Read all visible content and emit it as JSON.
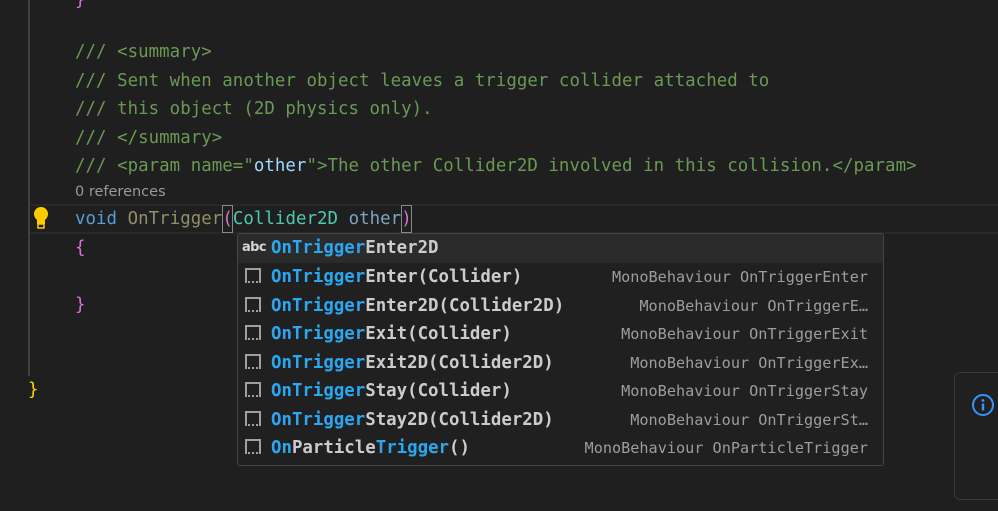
{
  "editor": {
    "lines": {
      "prev_brace": "}",
      "summary_open": "/// <summary>",
      "doc1": "/// Sent when another object leaves a trigger collider attached to",
      "doc2": "/// this object (2D physics only).",
      "summary_close": "/// </summary>",
      "param_prefix": "/// <param name=\"",
      "param_name": "other",
      "param_suffix": "\">The other Collider2D involved in this collision.</param>",
      "codelens": "0 references",
      "kw_void": "void",
      "method_name": "OnTrigger",
      "paren_open": "(",
      "param_type": "Collider2D",
      "param_var": "other",
      "paren_close": ")",
      "brace_open": "{",
      "brace_close": "}",
      "class_brace_close": "}"
    }
  },
  "suggest": {
    "items": [
      {
        "icon": "abc",
        "match": "OnTrigger",
        "rest": "Enter2D",
        "detail": "",
        "selected": true
      },
      {
        "icon": "snippet",
        "match": "OnTrigger",
        "rest": "Enter(Collider)",
        "detail": "MonoBehaviour OnTriggerEnter"
      },
      {
        "icon": "snippet",
        "match": "OnTrigger",
        "rest": "Enter2D(Collider2D)",
        "detail": "MonoBehaviour OnTriggerE…"
      },
      {
        "icon": "snippet",
        "match": "OnTrigger",
        "rest": "Exit(Collider)",
        "detail": "MonoBehaviour OnTriggerExit"
      },
      {
        "icon": "snippet",
        "match": "OnTrigger",
        "rest": "Exit2D(Collider2D)",
        "detail": "MonoBehaviour OnTriggerEx…"
      },
      {
        "icon": "snippet",
        "match": "OnTrigger",
        "rest": "Stay(Collider)",
        "detail": "MonoBehaviour OnTriggerStay"
      },
      {
        "icon": "snippet",
        "match": "OnTrigger",
        "rest": "Stay2D(Collider2D)",
        "detail": "MonoBehaviour OnTriggerSt…"
      },
      {
        "icon": "snippet",
        "pre": "On",
        "mid": "Particle",
        "match2": "Trigger",
        "rest": "()",
        "detail": "MonoBehaviour OnParticleTrigger"
      }
    ]
  },
  "notification": {
    "icon": "info-icon"
  }
}
